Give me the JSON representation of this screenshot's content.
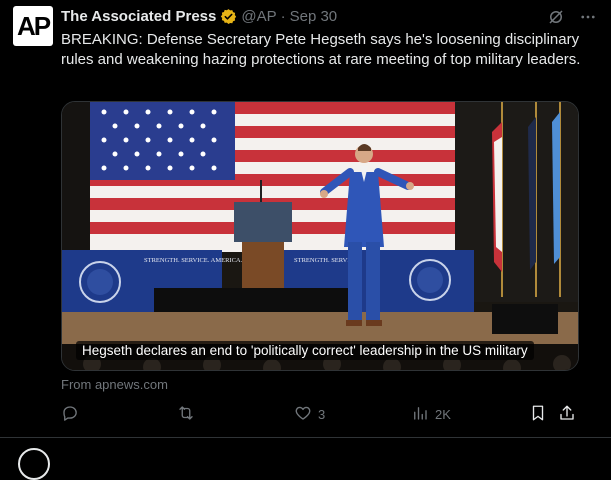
{
  "post": {
    "author_name": "The Associated Press",
    "avatar_text": "AP",
    "handle": "@AP",
    "separator": "·",
    "date": "Sep 30",
    "text": "BREAKING: Defense Secretary Pete Hegseth says he's loosening disciplinary rules and weakening hazing protections at rare meeting of top military leaders.",
    "verified_icon": "gold-checkmark-icon",
    "grok_icon": "grok-icon",
    "more_icon": "more-dots-icon"
  },
  "card": {
    "caption": "Hegseth declares an end to 'politically correct' leadership in the US military",
    "source": "From apnews.com",
    "banner_left": "STRENGTH. SERVICE. AMERICA.",
    "banner_right": "STRENGTH. SERVI"
  },
  "actions": {
    "reply_icon": "reply-icon",
    "repost_icon": "repost-icon",
    "like_icon": "heart-icon",
    "likes": "3",
    "views_icon": "views-icon",
    "views": "2K",
    "bookmark_icon": "bookmark-icon",
    "share_icon": "share-icon"
  },
  "colors": {
    "background": "#000000",
    "muted": "#71767b",
    "text": "#e7e9ea",
    "verified": "#e7b416"
  }
}
